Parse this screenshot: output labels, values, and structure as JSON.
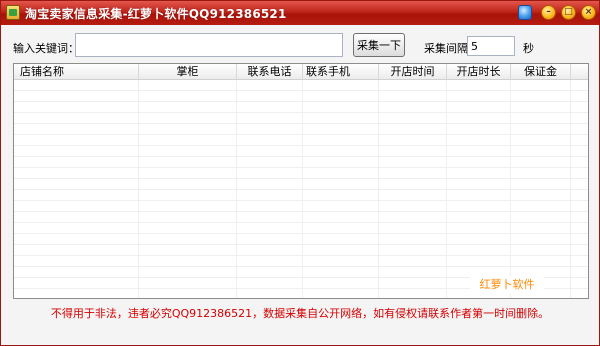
{
  "window": {
    "title": "淘宝卖家信息采集-红萝卜软件QQ912386521",
    "controls": [
      "skin-icon",
      "minimize-icon",
      "maximize-icon",
      "close-icon"
    ]
  },
  "search": {
    "keyword_label": "输入关键词：",
    "keyword_value": "",
    "collect_button": "采集一下",
    "interval_label": "采集间隔",
    "interval_value": "5",
    "interval_unit": "秒"
  },
  "table": {
    "columns": [
      "店铺名称",
      "掌柜",
      "联系电话",
      "联系手机",
      "开店时间",
      "开店时长",
      "保证金"
    ],
    "rows": []
  },
  "watermark": "红萝卜软件",
  "footer": "不得用于非法，违者必究QQ912386521，数据采集自公开网络，如有侵权请联系作者第一时间删除。",
  "colors": {
    "titlebar": "#c0251b",
    "footer_text": "#d40000",
    "watermark": "#ff8a00"
  }
}
